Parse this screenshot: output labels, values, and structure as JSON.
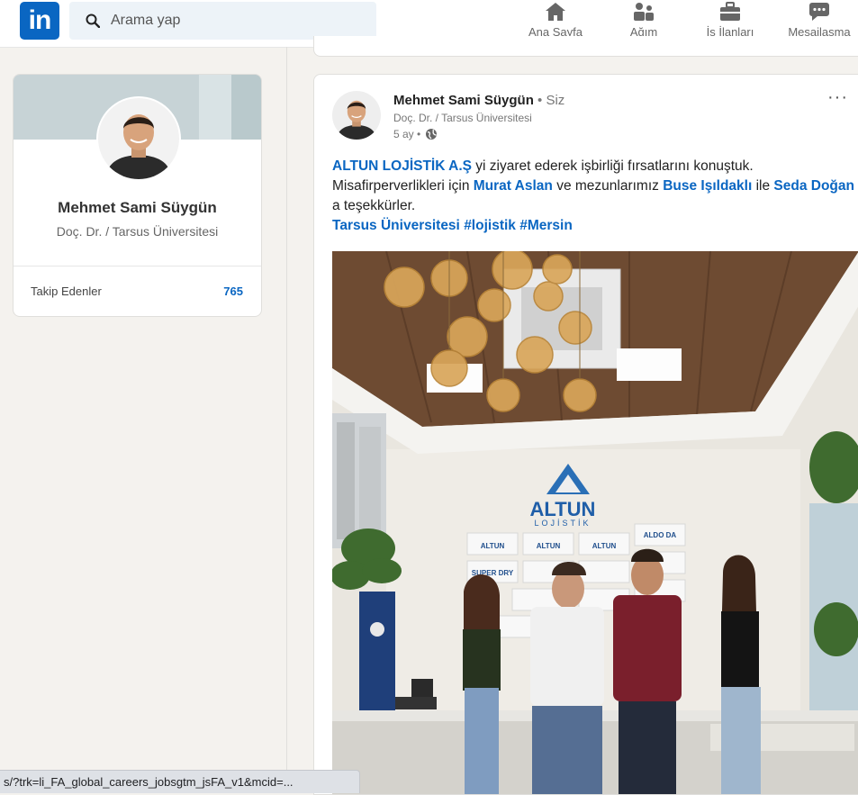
{
  "brand": {
    "logo_text": "in",
    "color": "#0a66c2"
  },
  "search": {
    "placeholder": "Arama yap"
  },
  "nav": {
    "home": "Ana Sayfa",
    "network": "Ağım",
    "jobs": "İş İlanları",
    "messaging": "Mesajlaşma"
  },
  "profile": {
    "name": "Mehmet Sami Süygün",
    "title": "Doç. Dr. / Tarsus Üniversitesi",
    "followers_label": "Takip Edenler",
    "followers_count": "765"
  },
  "post": {
    "author_name": "Mehmet Sami Süygün",
    "author_suffix": "Siz",
    "author_title": "Doç. Dr. / Tarsus Üniversitesi",
    "time": "5 ay",
    "more": "···",
    "text": {
      "mention1": "ALTUN LOJİSTİK A.Ş",
      "t1": " yi ziyaret ederek işbirliği fırsatlarını konuştuk. Misafirperverlikleri için ",
      "mention2": "Murat Aslan",
      "t2": " ve mezunlarımız ",
      "mention3": "Buse Işıldaklı",
      "t3": " ile ",
      "mention4": "Seda Doğan",
      "t4": " a teşekkürler.",
      "mention5": "Tarsus Üniversitesi",
      "tag1": "#lojistik",
      "tag2": "#Mersin"
    },
    "photo": {
      "sign_line1": "ALTUN",
      "sign_line2": "LOJİSTİK",
      "brand_badges": [
        "ALTUN",
        "ALTUN",
        "ALTUN",
        "ALDO DA",
        "SUPER DRY",
        "",
        "",
        "",
        "",
        "",
        "",
        ""
      ]
    }
  },
  "status_bar": {
    "url": "s/?trk=li_FA_global_careers_jobsgtm_jsFA_v1&mcid=..."
  }
}
